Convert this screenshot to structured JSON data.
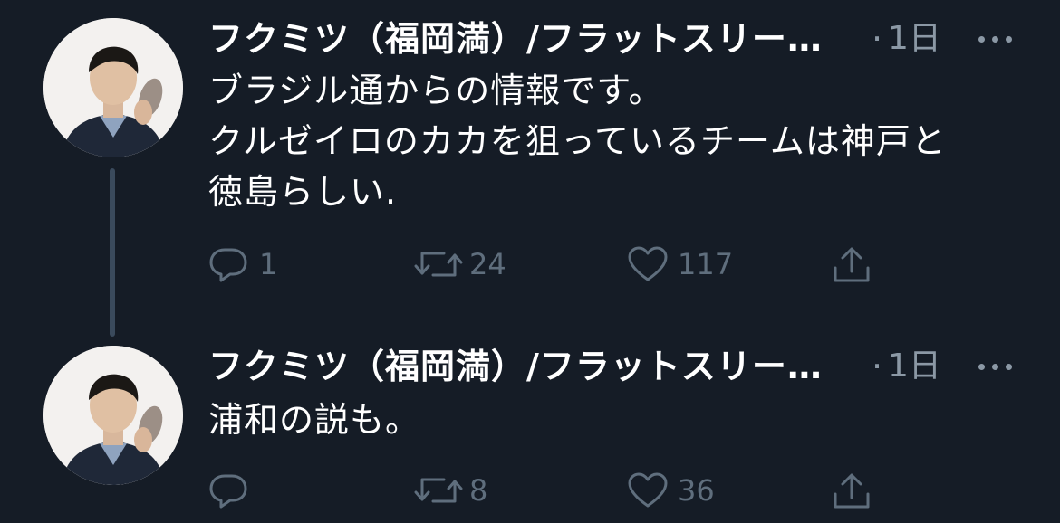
{
  "tweets": [
    {
      "author_name": "フクミツ（福岡満）/フラットスリー…",
      "separator": "·",
      "time": "1日",
      "text_lines": [
        "ブラジル通からの情報です。",
        "クルゼイロのカカを狙っているチームは神戸と",
        "徳島らしい."
      ],
      "reply_count": "1",
      "retweet_count": "24",
      "like_count": "117",
      "share_count": ""
    },
    {
      "author_name": "フクミツ（福岡満）/フラットスリー…",
      "separator": "·",
      "time": "1日",
      "text_lines": [
        "浦和の説も。"
      ],
      "reply_count": "",
      "retweet_count": "8",
      "like_count": "36",
      "share_count": ""
    }
  ],
  "icons": {
    "more": "more-dots-icon",
    "reply": "reply-bubble-icon",
    "retweet": "retweet-arrows-icon",
    "like": "heart-icon",
    "share": "share-upload-icon"
  },
  "colors": {
    "background": "#151c26",
    "text_primary": "#ffffff",
    "text_secondary": "#8b98a5",
    "action_gray": "#5f6e7d",
    "thread_line": "#3a4a5c"
  }
}
